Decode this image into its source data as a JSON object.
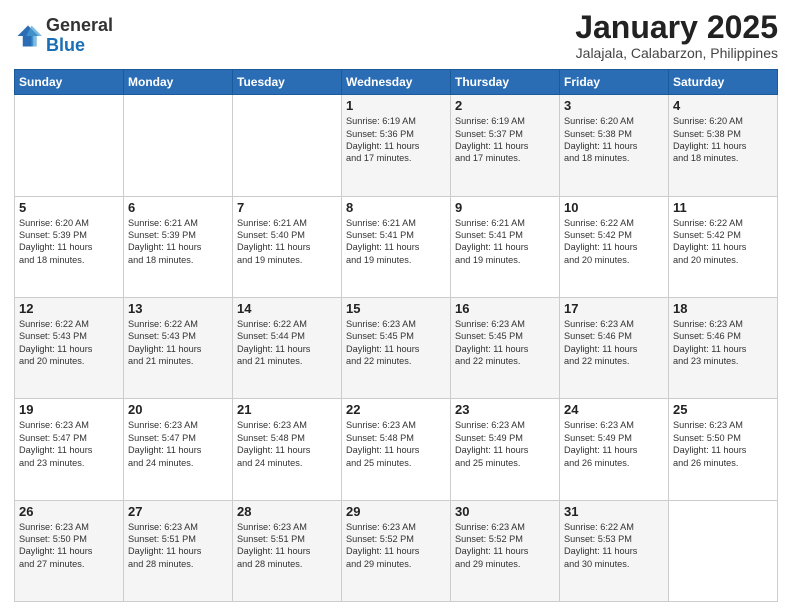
{
  "header": {
    "logo_general": "General",
    "logo_blue": "Blue",
    "month_title": "January 2025",
    "subtitle": "Jalajala, Calabarzon, Philippines"
  },
  "days_of_week": [
    "Sunday",
    "Monday",
    "Tuesday",
    "Wednesday",
    "Thursday",
    "Friday",
    "Saturday"
  ],
  "weeks": [
    [
      {
        "day": "",
        "text": ""
      },
      {
        "day": "",
        "text": ""
      },
      {
        "day": "",
        "text": ""
      },
      {
        "day": "1",
        "text": "Sunrise: 6:19 AM\nSunset: 5:36 PM\nDaylight: 11 hours\nand 17 minutes."
      },
      {
        "day": "2",
        "text": "Sunrise: 6:19 AM\nSunset: 5:37 PM\nDaylight: 11 hours\nand 17 minutes."
      },
      {
        "day": "3",
        "text": "Sunrise: 6:20 AM\nSunset: 5:38 PM\nDaylight: 11 hours\nand 18 minutes."
      },
      {
        "day": "4",
        "text": "Sunrise: 6:20 AM\nSunset: 5:38 PM\nDaylight: 11 hours\nand 18 minutes."
      }
    ],
    [
      {
        "day": "5",
        "text": "Sunrise: 6:20 AM\nSunset: 5:39 PM\nDaylight: 11 hours\nand 18 minutes."
      },
      {
        "day": "6",
        "text": "Sunrise: 6:21 AM\nSunset: 5:39 PM\nDaylight: 11 hours\nand 18 minutes."
      },
      {
        "day": "7",
        "text": "Sunrise: 6:21 AM\nSunset: 5:40 PM\nDaylight: 11 hours\nand 19 minutes."
      },
      {
        "day": "8",
        "text": "Sunrise: 6:21 AM\nSunset: 5:41 PM\nDaylight: 11 hours\nand 19 minutes."
      },
      {
        "day": "9",
        "text": "Sunrise: 6:21 AM\nSunset: 5:41 PM\nDaylight: 11 hours\nand 19 minutes."
      },
      {
        "day": "10",
        "text": "Sunrise: 6:22 AM\nSunset: 5:42 PM\nDaylight: 11 hours\nand 20 minutes."
      },
      {
        "day": "11",
        "text": "Sunrise: 6:22 AM\nSunset: 5:42 PM\nDaylight: 11 hours\nand 20 minutes."
      }
    ],
    [
      {
        "day": "12",
        "text": "Sunrise: 6:22 AM\nSunset: 5:43 PM\nDaylight: 11 hours\nand 20 minutes."
      },
      {
        "day": "13",
        "text": "Sunrise: 6:22 AM\nSunset: 5:43 PM\nDaylight: 11 hours\nand 21 minutes."
      },
      {
        "day": "14",
        "text": "Sunrise: 6:22 AM\nSunset: 5:44 PM\nDaylight: 11 hours\nand 21 minutes."
      },
      {
        "day": "15",
        "text": "Sunrise: 6:23 AM\nSunset: 5:45 PM\nDaylight: 11 hours\nand 22 minutes."
      },
      {
        "day": "16",
        "text": "Sunrise: 6:23 AM\nSunset: 5:45 PM\nDaylight: 11 hours\nand 22 minutes."
      },
      {
        "day": "17",
        "text": "Sunrise: 6:23 AM\nSunset: 5:46 PM\nDaylight: 11 hours\nand 22 minutes."
      },
      {
        "day": "18",
        "text": "Sunrise: 6:23 AM\nSunset: 5:46 PM\nDaylight: 11 hours\nand 23 minutes."
      }
    ],
    [
      {
        "day": "19",
        "text": "Sunrise: 6:23 AM\nSunset: 5:47 PM\nDaylight: 11 hours\nand 23 minutes."
      },
      {
        "day": "20",
        "text": "Sunrise: 6:23 AM\nSunset: 5:47 PM\nDaylight: 11 hours\nand 24 minutes."
      },
      {
        "day": "21",
        "text": "Sunrise: 6:23 AM\nSunset: 5:48 PM\nDaylight: 11 hours\nand 24 minutes."
      },
      {
        "day": "22",
        "text": "Sunrise: 6:23 AM\nSunset: 5:48 PM\nDaylight: 11 hours\nand 25 minutes."
      },
      {
        "day": "23",
        "text": "Sunrise: 6:23 AM\nSunset: 5:49 PM\nDaylight: 11 hours\nand 25 minutes."
      },
      {
        "day": "24",
        "text": "Sunrise: 6:23 AM\nSunset: 5:49 PM\nDaylight: 11 hours\nand 26 minutes."
      },
      {
        "day": "25",
        "text": "Sunrise: 6:23 AM\nSunset: 5:50 PM\nDaylight: 11 hours\nand 26 minutes."
      }
    ],
    [
      {
        "day": "26",
        "text": "Sunrise: 6:23 AM\nSunset: 5:50 PM\nDaylight: 11 hours\nand 27 minutes."
      },
      {
        "day": "27",
        "text": "Sunrise: 6:23 AM\nSunset: 5:51 PM\nDaylight: 11 hours\nand 28 minutes."
      },
      {
        "day": "28",
        "text": "Sunrise: 6:23 AM\nSunset: 5:51 PM\nDaylight: 11 hours\nand 28 minutes."
      },
      {
        "day": "29",
        "text": "Sunrise: 6:23 AM\nSunset: 5:52 PM\nDaylight: 11 hours\nand 29 minutes."
      },
      {
        "day": "30",
        "text": "Sunrise: 6:23 AM\nSunset: 5:52 PM\nDaylight: 11 hours\nand 29 minutes."
      },
      {
        "day": "31",
        "text": "Sunrise: 6:22 AM\nSunset: 5:53 PM\nDaylight: 11 hours\nand 30 minutes."
      },
      {
        "day": "",
        "text": ""
      }
    ]
  ]
}
